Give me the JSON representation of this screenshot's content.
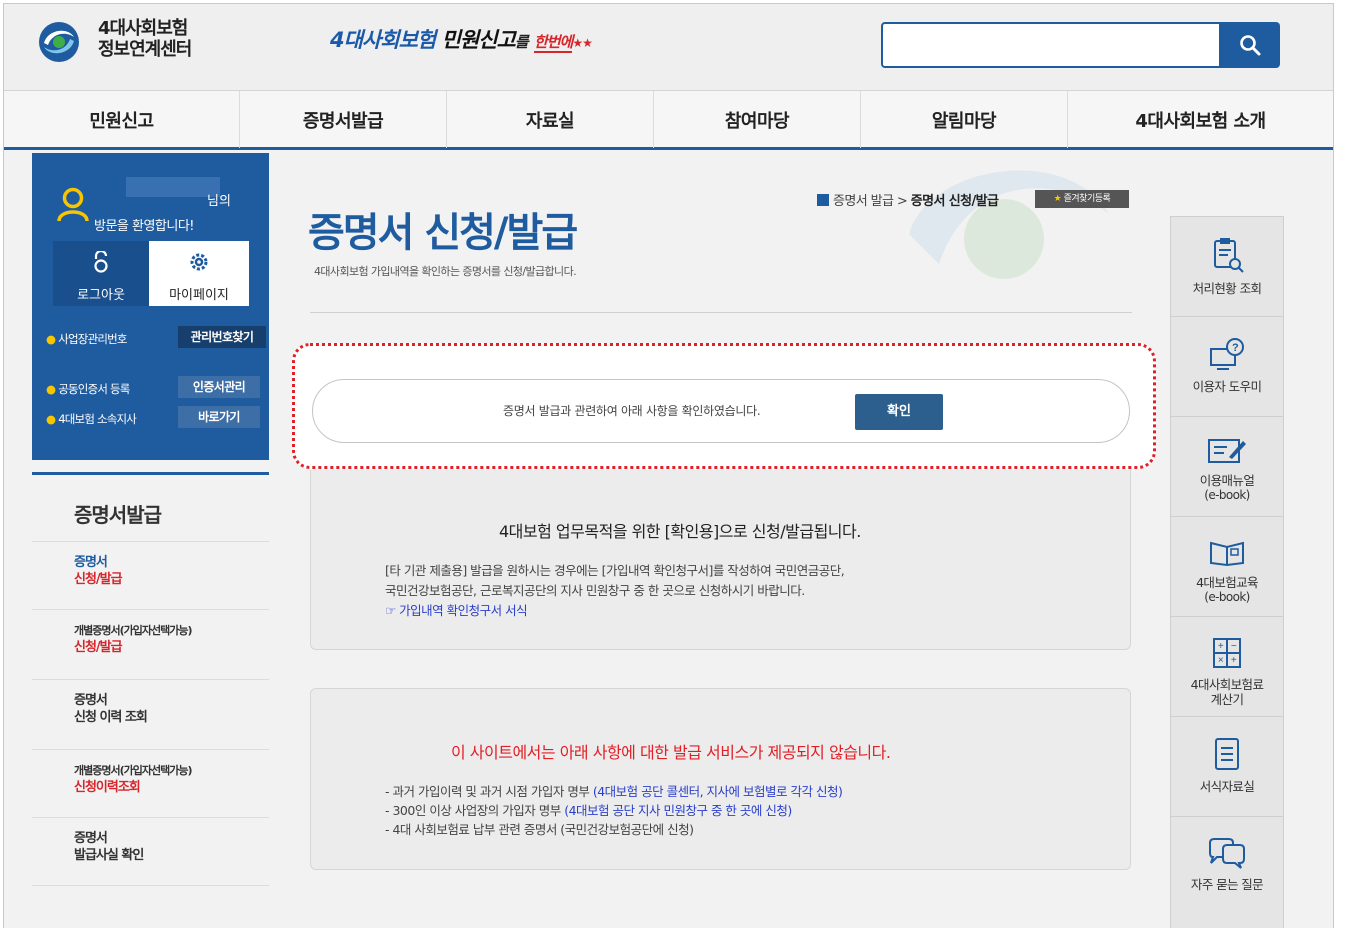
{
  "header": {
    "logo_line1": "4대사회보험",
    "logo_line2": "정보연계센터",
    "slogan_a": "4대사회보험",
    "slogan_b": "민원신고",
    "slogan_c": "를",
    "slogan_d": "한번에",
    "search_placeholder": ""
  },
  "nav": [
    {
      "label": "민원신고"
    },
    {
      "label": "증명서발급"
    },
    {
      "label": "자료실"
    },
    {
      "label": "참여마당"
    },
    {
      "label": "알림마당"
    },
    {
      "label": "4대사회보험 소개"
    }
  ],
  "user": {
    "suffix": "님의",
    "welcome": "방문을 환영합니다!",
    "logout": "로그아웃",
    "mypage": "마이페이지",
    "biz_no_label": "사업장관리번호",
    "biz_no_btn": "관리번호찾기",
    "cert_label": "공동인증서 등록",
    "cert_btn": "인증서관리",
    "branch_label": "4대보험 소속지사",
    "branch_btn": "바로가기"
  },
  "sidemenu": {
    "title": "증명서발급",
    "items": [
      {
        "l1": "증명서",
        "l2": "신청/발급"
      },
      {
        "l1": "개별증명서(가입자선택가능)",
        "l2": "신청/발급"
      },
      {
        "l1": "증명서",
        "l2": "신청 이력 조회"
      },
      {
        "l1": "개별증명서(가입자선택가능)",
        "l2": "신청이력조회"
      },
      {
        "l1": "증명서",
        "l2": "발급사실 확인"
      }
    ]
  },
  "breadcrumb": {
    "parent": "증명서 발급",
    "sep": ">",
    "current": "증명서 신청/발급",
    "fav": "즐겨찾기등록"
  },
  "page": {
    "title": "증명서 신청/발급",
    "desc": "4대사회보험 가입내역을 확인하는 증명서를 신청/발급합니다."
  },
  "confirm": {
    "text": "증명서 발급과 관련하여 아래 사항을 확인하였습니다.",
    "button": "확인"
  },
  "info1": {
    "heading": "4대보험 업무목적을 위한 [확인용]으로 신청/발급됩니다.",
    "line1": "[타 기관 제출용] 발급을 원하시는 경우에는 [가입내역 확인청구서]를 작성하여 국민연금공단,",
    "line2": "국민건강보험공단, 근로복지공단의 지사 민원창구 중 한 곳으로 신청하시기 바랍니다.",
    "link": "☞ 가입내역 확인청구서 서식"
  },
  "info2": {
    "heading": "이 사이트에서는 아래 사항에 대한 발급 서비스가 제공되지 않습니다.",
    "items": [
      {
        "text": "- 과거 가입이력 및 과거 시점 가입자 명부 ",
        "link": "(4대보험 공단 콜센터, 지사에 보험별로 각각 신청)"
      },
      {
        "text": "- 300인 이상 사업장의 가입자 명부 ",
        "link": "(4대보험 공단 지사 민원창구 중 한 곳에 신청)"
      },
      {
        "text": "- 4대 사회보험료 납부 관련 증명서 (국민건강보험공단에 신청)",
        "link": ""
      }
    ]
  },
  "quick": [
    {
      "l1": "처리현황 조회",
      "l2": "",
      "icon": "clipboard-search-icon"
    },
    {
      "l1": "이용자 도우미",
      "l2": "",
      "icon": "monitor-help-icon"
    },
    {
      "l1": "이용매뉴얼",
      "l2": "(e-book)",
      "icon": "pencil-note-icon"
    },
    {
      "l1": "4대보험교육",
      "l2": "(e-book)",
      "icon": "open-book-icon"
    },
    {
      "l1": "4대사회보험료",
      "l2": "계산기",
      "icon": "calculator-icon"
    },
    {
      "l1": "서식자료실",
      "l2": "",
      "icon": "document-icon"
    },
    {
      "l1": "자주 묻는 질문",
      "l2": "",
      "icon": "speech-bubble-icon"
    }
  ],
  "colors": {
    "primary": "#1f5b9f",
    "accent_red": "#e21f26",
    "link_blue": "#2a3fc9"
  }
}
